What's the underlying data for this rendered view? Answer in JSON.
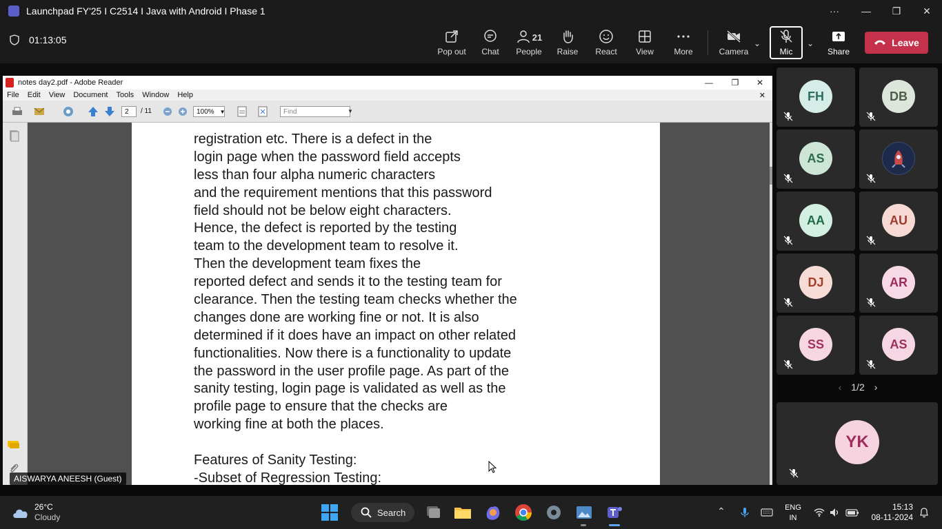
{
  "teams": {
    "window_title": "Launchpad FY'25 I C2514 I Java with Android I Phase 1",
    "timer": "01:13:05",
    "toolbar": {
      "popout": "Pop out",
      "chat": "Chat",
      "people": "People",
      "people_count": "21",
      "raise": "Raise",
      "react": "React",
      "view": "View",
      "more": "More",
      "camera": "Camera",
      "mic": "Mic",
      "share": "Share",
      "leave": "Leave"
    },
    "accent": "#c4314b"
  },
  "reader": {
    "title": "notes day2.pdf - Adobe Reader",
    "menu": [
      "File",
      "Edit",
      "View",
      "Document",
      "Tools",
      "Window",
      "Help"
    ],
    "page_current": "2",
    "page_total": "/ 11",
    "zoom": "100%",
    "find_placeholder": "Find",
    "text_lines": [
      "registration etc. There is a defect in the",
      "login page when the password field accepts",
      "less than four alpha numeric characters",
      "and the requirement mentions that this password",
      "field should not be below eight characters.",
      "Hence, the defect is reported by the testing",
      "team to the development team to resolve it.",
      "Then the development team fixes the",
      "reported defect and sends it to the testing team for",
      "clearance. Then the testing team checks whether the",
      "changes done are working fine or not. It is also",
      "determined if it does have an impact on other related",
      "functionalities. Now there is a functionality to update",
      "the password in the user profile page. As part of the",
      "sanity testing, login page is validated as well as the",
      "profile page to ensure that the checks are",
      "working fine at both the places.",
      "",
      "Features of Sanity Testing:",
      "-Subset of Regression Testing:"
    ]
  },
  "presenter_caption": "AISWARYA ANEESH (Guest)",
  "participants": [
    {
      "initials": "FH",
      "bg": "#d5ede6",
      "fg": "#2d6e5d"
    },
    {
      "initials": "DB",
      "bg": "#dde6da",
      "fg": "#4e5d4a"
    },
    {
      "initials": "AS",
      "bg": "#cde5d6",
      "fg": "#2f6a4a"
    },
    {
      "initials": "",
      "bg": "#1d2a4a",
      "fg": "#ffffff"
    },
    {
      "initials": "AA",
      "bg": "#d3efe1",
      "fg": "#1f6b47"
    },
    {
      "initials": "AU",
      "bg": "#f7d9d3",
      "fg": "#9c3b2e"
    },
    {
      "initials": "DJ",
      "bg": "#f6dcd4",
      "fg": "#a43f2a"
    },
    {
      "initials": "AR",
      "bg": "#f7d8e5",
      "fg": "#9a2c5c"
    },
    {
      "initials": "SS",
      "bg": "#f5d6e1",
      "fg": "#a03160"
    },
    {
      "initials": "AS",
      "bg": "#f6d6e3",
      "fg": "#9b2f5d"
    }
  ],
  "pager": "1/2",
  "featured": {
    "initials": "YK",
    "bg": "#f5d4e0",
    "fg": "#a02c5b"
  },
  "taskbar": {
    "weather_temp": "26°C",
    "weather_desc": "Cloudy",
    "search": "Search",
    "lang_top": "ENG",
    "lang_bottom": "IN",
    "time": "15:13",
    "date": "08-11-2024"
  }
}
